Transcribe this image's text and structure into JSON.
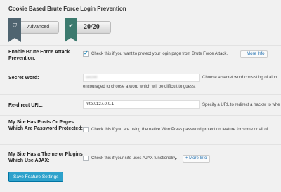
{
  "section_title": "Cookie Based Brute Force Login Prevention",
  "grade": {
    "level_label": "Advanced",
    "score": "20/20"
  },
  "rows": {
    "enable": {
      "label": "Enable Brute Force Attack Prevention:",
      "checked": true,
      "description": "Check this if you want to protect your login page from Brute Force Attack.",
      "more_info": "+ More Info"
    },
    "secret_word": {
      "label": "Secret Word:",
      "value": "secret",
      "description_line1": "Choose a secret word consisting of alph",
      "description_line2": "encouraged to choose a word which will be difficult to guess."
    },
    "redirect": {
      "label": "Re-direct URL:",
      "value": "http://127.0.0.1",
      "description": "Specify a URL to redirect a hacker to whe"
    },
    "posts_protected": {
      "label": "My Site Has Posts Or Pages Which Are Password Protected:",
      "checked": false,
      "description": "Check this if you are using the native WordPress password protection feature for some or all of"
    },
    "ajax": {
      "label": "My Site Has a Theme or Plugins Which Use AJAX:",
      "checked": false,
      "description": "Check this if your site uses AJAX functionality.",
      "more_info": "+ More Info"
    }
  },
  "save_button": "Save Feature Settings",
  "colors": {
    "primary_button": "#2ea2cc",
    "ribbon_dark": "#4f6470",
    "ribbon_green": "#3c7a6e"
  },
  "icons": {
    "advanced": "shield-icon",
    "score": "lock-icon"
  }
}
